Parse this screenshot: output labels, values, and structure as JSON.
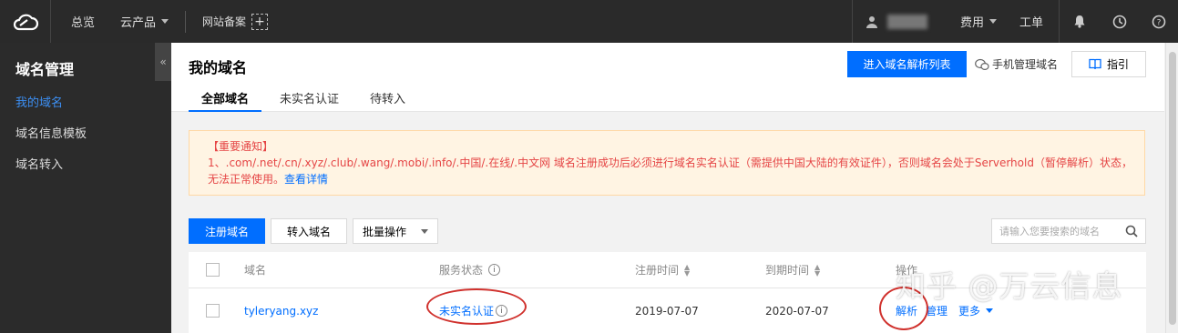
{
  "topbar": {
    "overview": "总览",
    "products": "云产品",
    "icp": "网站备案",
    "billing": "费用",
    "ticket": "工单"
  },
  "sidebar": {
    "title": "域名管理",
    "items": [
      {
        "label": "我的域名"
      },
      {
        "label": "域名信息模板"
      },
      {
        "label": "域名转入"
      }
    ]
  },
  "header": {
    "title": "我的域名",
    "tabs": [
      {
        "label": "全部域名"
      },
      {
        "label": "未实名认证"
      },
      {
        "label": "待转入"
      }
    ],
    "resolve_list_button": "进入域名解析列表",
    "mobile_manage": "手机管理域名",
    "guide_button": "指引"
  },
  "notice": {
    "title": "【重要通知】",
    "body": "1、.com/.net/.cn/.xyz/.club/.wang/.mobi/.info/.中国/.在线/.中文网 域名注册成功后必须进行域名实名认证（需提供中国大陆的有效证件），否则域名会处于Serverhold（暂停解析）状态，无法正常使用。",
    "link": "查看详情"
  },
  "toolbar": {
    "register": "注册域名",
    "transfer": "转入域名",
    "batch": "批量操作",
    "search_placeholder": "请输入您要搜索的域名"
  },
  "table": {
    "headers": {
      "domain": "域名",
      "status": "服务状态",
      "reg_time": "注册时间",
      "exp_time": "到期时间",
      "actions": "操作"
    },
    "rows": [
      {
        "domain": "tyleryang.xyz",
        "status": "未实名认证",
        "reg_time": "2019-07-07",
        "exp_time": "2020-07-07",
        "action_resolve": "解析",
        "action_manage": "管理",
        "action_more": "更多"
      }
    ]
  },
  "watermark": "知乎 @万云信息",
  "colors": {
    "accent": "#006eff",
    "topbar_bg": "#2a2a2a",
    "sidebar_bg": "#2b2b2b",
    "notice_text": "#e54545",
    "annotation_red": "#d0312d"
  }
}
